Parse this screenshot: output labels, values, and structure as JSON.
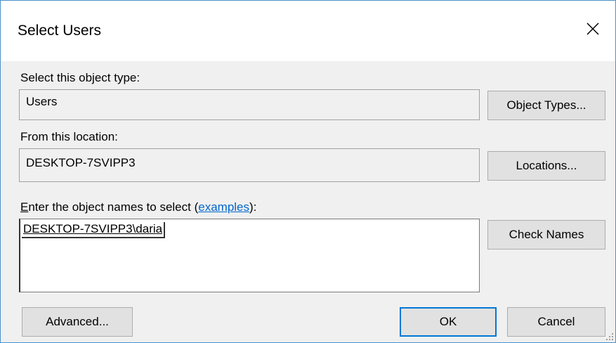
{
  "window": {
    "title": "Select Users"
  },
  "object_type": {
    "label": "Select this object type:",
    "value": "Users",
    "button_label": "Object Types..."
  },
  "location": {
    "label": "From this location:",
    "value": "DESKTOP-7SVIPP3",
    "button_label": "Locations..."
  },
  "names": {
    "label_accel": "E",
    "label_main": "nter the object names to select (",
    "label_link": "examples",
    "label_tail": "):",
    "value": "DESKTOP-7SVIPP3\\daria",
    "check_button_label": "Check Names"
  },
  "footer": {
    "advanced_label": "Advanced...",
    "ok_label": "OK",
    "cancel_label": "Cancel"
  },
  "icons": {
    "close": "close-icon",
    "resize": "resize-grip-icon"
  }
}
